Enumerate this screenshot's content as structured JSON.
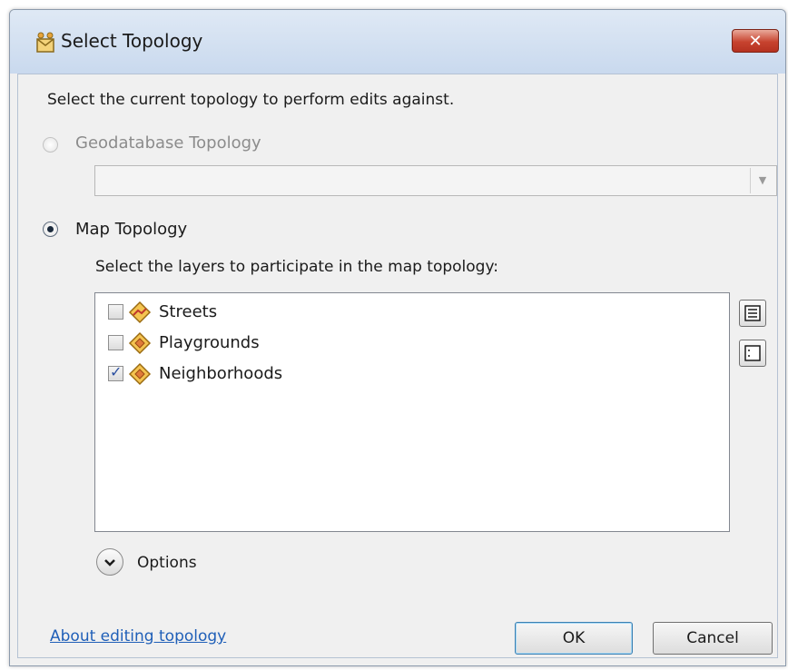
{
  "window": {
    "title": "Select Topology",
    "close_label": "✕"
  },
  "instruction": "Select the current topology to perform edits against.",
  "geodatabase_topology": {
    "label": "Geodatabase Topology",
    "selected": false,
    "enabled": false,
    "combo_value": ""
  },
  "map_topology": {
    "label": "Map Topology",
    "selected": true,
    "enabled": true
  },
  "layers_instruction": "Select the layers to participate in the map topology:",
  "layers": [
    {
      "label": "Streets",
      "checked": false,
      "icon": "line-layer-icon"
    },
    {
      "label": "Playgrounds",
      "checked": false,
      "icon": "polygon-layer-icon"
    },
    {
      "label": "Neighborhoods",
      "checked": true,
      "icon": "polygon-layer-icon"
    }
  ],
  "side_buttons": {
    "select_all_icon": "select-all-icon",
    "clear_all_icon": "clear-all-icon"
  },
  "options": {
    "label": "Options",
    "icon": "chevron-down-icon"
  },
  "footer": {
    "help_link": "About editing topology",
    "ok_label": "OK",
    "cancel_label": "Cancel"
  },
  "colors": {
    "link": "#1f5fb8",
    "close_button": "#c7432f",
    "ok_border": "#3c7fb1",
    "check": "#2b4fa0"
  }
}
